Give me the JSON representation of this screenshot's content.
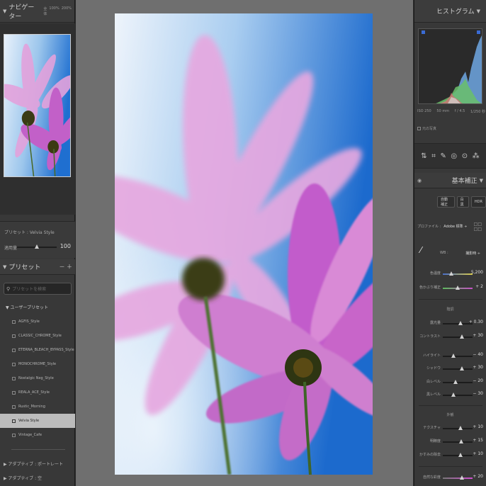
{
  "colors": {
    "panel": "#383838",
    "header": "#3c3c3c",
    "center": "#6f6f6f",
    "selected": "#bcbcbc"
  },
  "navigator": {
    "title": "ナビゲーター",
    "zoom": [
      "全体",
      "100%",
      "200%"
    ]
  },
  "preset_info": {
    "label": "プリセット : Velvia Style",
    "amount_label": "適用量",
    "amount_value": "100"
  },
  "presets_panel": {
    "title": "プリセット",
    "add": "－ ＋",
    "search_placeholder": "プリセットを検索",
    "group": "ユーザープリセット",
    "items": [
      {
        "label": "AGFIS_Style",
        "selected": false
      },
      {
        "label": "CLASSIC_CHROME_Style",
        "selected": false
      },
      {
        "label": "ETERNA_BLEACH_BYPASS_Style",
        "selected": false
      },
      {
        "label": "MONOCHROME_Style",
        "selected": false
      },
      {
        "label": "Nostalgic Neg_Style",
        "selected": false
      },
      {
        "label": "REALA_ACE_Style",
        "selected": false
      },
      {
        "label": "Rustic_Morning",
        "selected": false
      },
      {
        "label": "Velvia Style",
        "selected": true
      },
      {
        "label": "Vintage_Cafe",
        "selected": false
      }
    ],
    "adaptive_portrait": "アダプティブ : ポートレート",
    "adaptive_sky": "アダプティブ : 空"
  },
  "histogram": {
    "title": "ヒストグラム",
    "exif": [
      "ISO 250",
      "50 mm",
      "f / 4.5",
      "1/250 秒"
    ],
    "original_photo": "元の写真"
  },
  "basic": {
    "title": "基本補正",
    "buttons": [
      "自動補正",
      "白黒",
      "HDR"
    ],
    "profile_label": "プロファイル :",
    "profile_value": "Adobe 標準 ÷",
    "wb_label": "WB :",
    "wb_value": "撮影時 ÷",
    "sliders": {
      "temp": {
        "label": "色温度",
        "value": "5,200"
      },
      "tint": {
        "label": "色かぶり補正",
        "value": "+ 2"
      },
      "tone_header": "階調",
      "exposure": {
        "label": "露光量",
        "value": "+ 0.30"
      },
      "contrast": {
        "label": "コントラスト",
        "value": "+ 30"
      },
      "highlights": {
        "label": "ハイライト",
        "value": "− 40"
      },
      "shadows": {
        "label": "シャドウ",
        "value": "+ 30"
      },
      "whites": {
        "label": "白レベル",
        "value": "− 20"
      },
      "blacks": {
        "label": "黒レベル",
        "value": "− 30"
      },
      "presence_header": "外観",
      "texture": {
        "label": "テクスチャ",
        "value": "+ 10"
      },
      "clarity": {
        "label": "明瞭度",
        "value": "+ 15"
      },
      "dehaze": {
        "label": "かすみの除去",
        "value": "+ 10"
      },
      "vibrance": {
        "label": "自然な彩度",
        "value": "+ 20"
      }
    }
  }
}
